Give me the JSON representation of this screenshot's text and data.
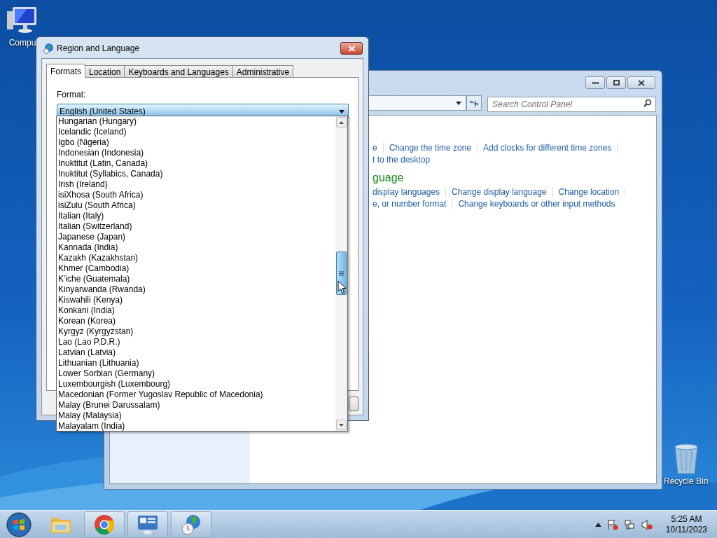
{
  "desktop_icons": [
    {
      "label": "Compu",
      "kind": "computer"
    },
    {
      "label": "Recycle Bin",
      "kind": "recycle"
    }
  ],
  "control_panel": {
    "search": {
      "placeholder": "Search Control Panel"
    },
    "link_rows": [
      {
        "links": [
          "e",
          "Change the time zone",
          "Add clocks for different time zones"
        ],
        "trailing_separator": true
      },
      {
        "links": [
          "t to the desktop"
        ],
        "trailing_separator": false
      }
    ],
    "heading": "guage",
    "link_rows_2": [
      {
        "links": [
          "display languages",
          "Change display language",
          "Change location"
        ],
        "trailing_separator": true
      },
      {
        "links": [
          "e, or number format",
          "Change keyboards or other input methods"
        ],
        "trailing_separator": false
      }
    ]
  },
  "dialog": {
    "title": "Region and Language",
    "tabs": [
      {
        "label": "Formats",
        "selected": true
      },
      {
        "label": "Location",
        "selected": false
      },
      {
        "label": "Keyboards and Languages",
        "selected": false
      },
      {
        "label": "Administrative",
        "selected": false
      }
    ],
    "format_label": "Format:",
    "format_value": "English (United States)",
    "options": [
      "Hungarian (Hungary)",
      "Icelandic (Iceland)",
      "Igbo (Nigeria)",
      "Indonesian (Indonesia)",
      "Inuktitut (Latin, Canada)",
      "Inuktitut (Syllabics, Canada)",
      "Irish (Ireland)",
      "isiXhosa (South Africa)",
      "isiZulu (South Africa)",
      "Italian (Italy)",
      "Italian (Switzerland)",
      "Japanese (Japan)",
      "Kannada (India)",
      "Kazakh (Kazakhstan)",
      "Khmer (Cambodia)",
      "K'iche (Guatemala)",
      "Kinyarwanda (Rwanda)",
      "Kiswahili (Kenya)",
      "Konkani (India)",
      "Korean (Korea)",
      "Kyrgyz (Kyrgyzstan)",
      "Lao (Lao P.D.R.)",
      "Latvian (Latvia)",
      "Lithuanian (Lithuania)",
      "Lower Sorbian (Germany)",
      "Luxembourgish (Luxembourg)",
      "Macedonian (Former Yugoslav Republic of Macedonia)",
      "Malay (Brunei Darussalam)",
      "Malay (Malaysia)",
      "Malayalam (India)"
    ]
  },
  "taskbar": {
    "apps": [
      {
        "kind": "folder"
      },
      {
        "kind": "chrome"
      },
      {
        "kind": "control-panel"
      },
      {
        "kind": "globe"
      }
    ],
    "clock": {
      "time": "5:25 AM",
      "date": "10/11/2023"
    }
  }
}
